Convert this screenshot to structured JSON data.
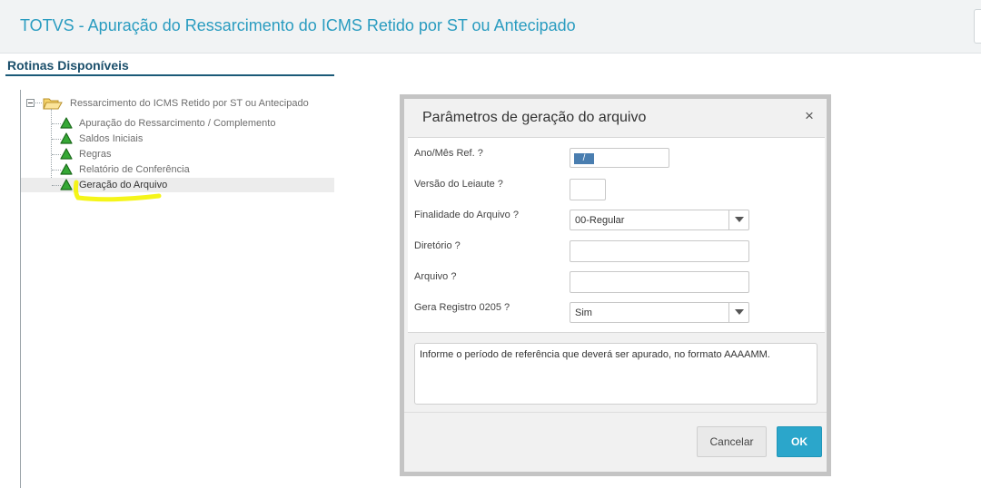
{
  "app": {
    "title": "TOTVS - Apuração do Ressarcimento do ICMS Retido por ST ou Antecipado"
  },
  "panel": {
    "title": "Rotinas Disponíveis"
  },
  "tree": {
    "root": {
      "label": "Ressarcimento do ICMS Retido por ST ou Antecipado",
      "icon": "folder-open-icon"
    },
    "items": [
      {
        "label": "Apuração do Ressarcimento / Complemento",
        "icon": "green-triangle-icon"
      },
      {
        "label": "Saldos Iniciais",
        "icon": "green-triangle-icon"
      },
      {
        "label": "Regras",
        "icon": "green-triangle-icon"
      },
      {
        "label": "Relatório de Conferência",
        "icon": "green-triangle-icon"
      },
      {
        "label": "Geração do Arquivo",
        "icon": "green-triangle-icon",
        "selected": true
      }
    ]
  },
  "modal": {
    "title": "Parâmetros de geração do arquivo",
    "fields": {
      "ano_mes": {
        "label": "Ano/Mês Ref. ?",
        "value": "/"
      },
      "versao": {
        "label": "Versão do Leiaute ?",
        "value": ""
      },
      "finalidade": {
        "label": "Finalidade do Arquivo ?",
        "value": "00-Regular"
      },
      "diretorio": {
        "label": "Diretório ?",
        "value": ""
      },
      "arquivo": {
        "label": "Arquivo ?",
        "value": ""
      },
      "gera_registro": {
        "label": "Gera Registro 0205 ?",
        "value": "Sim"
      }
    },
    "help_text": "Informe o período de referência que deverá ser apurado, no formato AAAAMM.",
    "buttons": {
      "cancel": "Cancelar",
      "ok": "OK"
    }
  },
  "colors": {
    "accent": "#2a9cc0",
    "ok_button": "#2ba6cb",
    "highlight": "#f4f400",
    "tree_icon": "#2e9a2e"
  }
}
